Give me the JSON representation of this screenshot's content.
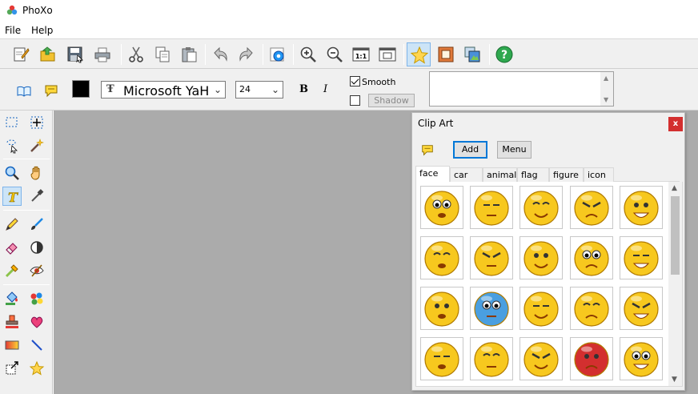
{
  "window": {
    "title": "PhoXo"
  },
  "menu": [
    "File",
    "Help"
  ],
  "toolbar": {
    "buttons": [
      {
        "name": "new-document",
        "icon": "new-document-icon"
      },
      {
        "name": "open",
        "icon": "open-folder-icon"
      },
      {
        "name": "save",
        "icon": "save-icon"
      },
      {
        "name": "print",
        "icon": "printer-icon"
      },
      {
        "name": "cut",
        "icon": "scissors-icon"
      },
      {
        "name": "copy",
        "icon": "copy-icon"
      },
      {
        "name": "paste",
        "icon": "paste-icon"
      },
      {
        "name": "undo",
        "icon": "undo-icon"
      },
      {
        "name": "redo",
        "icon": "redo-icon"
      },
      {
        "name": "settings",
        "icon": "gear-icon"
      },
      {
        "name": "zoom-in",
        "icon": "zoom-in-icon"
      },
      {
        "name": "zoom-out",
        "icon": "zoom-out-icon"
      },
      {
        "name": "actual-size",
        "icon": "actual-size-icon",
        "label": "1:1"
      },
      {
        "name": "fit-window",
        "icon": "fit-window-icon"
      },
      {
        "name": "effects",
        "icon": "star-icon",
        "pressed": true
      },
      {
        "name": "frame",
        "icon": "frame-icon"
      },
      {
        "name": "layers",
        "icon": "layers-icon"
      },
      {
        "name": "help",
        "icon": "help-icon",
        "label": "?"
      }
    ]
  },
  "textbar": {
    "font": {
      "icon_glyph": "Ŧ",
      "value": "Microsoft YaH"
    },
    "size": "24",
    "bold": "B",
    "italic": "I",
    "smooth": {
      "label": "Smooth",
      "checked": true
    },
    "shadow": {
      "label": "Shadow",
      "checked": false
    },
    "text_value": ""
  },
  "clipart": {
    "title": "Clip Art",
    "close": "x",
    "add": "Add",
    "menu": "Menu",
    "tabs": [
      "face",
      "car",
      "animal",
      "flag",
      "figure",
      "icon"
    ],
    "active_tab": "face"
  },
  "colors": {
    "accent": "#0078d7",
    "canvas": "#ababab",
    "face_yellow": "#f7c81e",
    "close_red": "#d32f2f"
  }
}
